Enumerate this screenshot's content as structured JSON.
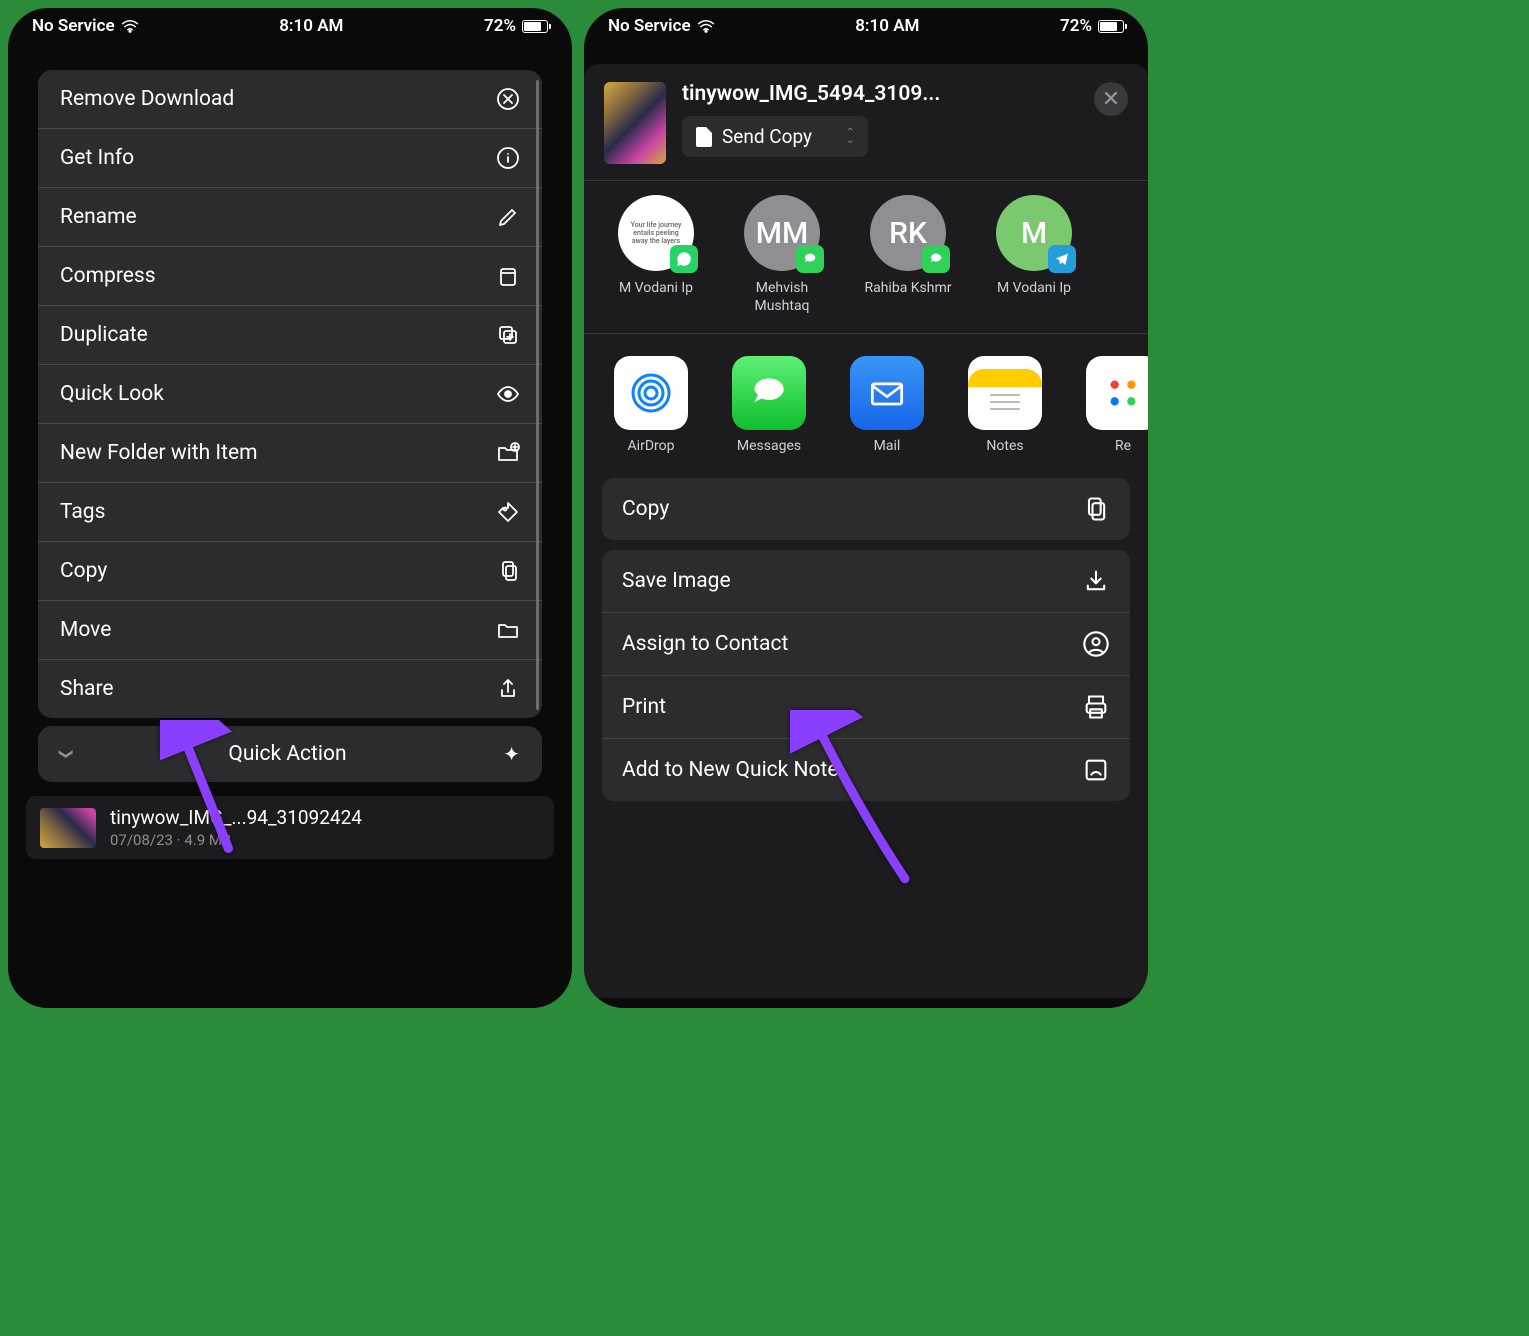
{
  "status": {
    "service": "No Service",
    "time": "8:10 AM",
    "battery": "72%"
  },
  "left": {
    "menu": [
      {
        "label": "Remove Download",
        "icon": "remove-icon"
      },
      {
        "label": "Get Info",
        "icon": "info-icon"
      },
      {
        "label": "Rename",
        "icon": "rename-icon"
      },
      {
        "label": "Compress",
        "icon": "compress-icon"
      },
      {
        "label": "Duplicate",
        "icon": "duplicate-icon"
      },
      {
        "label": "Quick Look",
        "icon": "eye-icon"
      },
      {
        "label": "New Folder with Item",
        "icon": "folder-plus-icon"
      },
      {
        "label": "Tags",
        "icon": "tag-icon"
      },
      {
        "label": "Copy",
        "icon": "copy-icon"
      },
      {
        "label": "Move",
        "icon": "folder-icon"
      },
      {
        "label": "Share",
        "icon": "share-icon"
      }
    ],
    "quick_actions": "Quick Action",
    "file": {
      "name": "tinywow_IMG_...94_31092424",
      "sub": "07/08/23 · 4.9 MB"
    }
  },
  "right": {
    "title": "tinywow_IMG_5494_3109...",
    "send_copy": "Send Copy",
    "contacts": [
      {
        "name": "M Vodani Ip",
        "initials": "",
        "bg": "#fff",
        "badge": "#25d366"
      },
      {
        "name": "Mehvish Mushtaq",
        "initials": "MM",
        "bg": "#8e8e93",
        "badge": "#30d158"
      },
      {
        "name": "Rahiba Kshmr",
        "initials": "RK",
        "bg": "#8e8e93",
        "badge": "#30d158"
      },
      {
        "name": "M Vodani Ip",
        "initials": "M",
        "bg": "#7bc96f",
        "badge": "#229ed9"
      }
    ],
    "apps": [
      {
        "name": "AirDrop",
        "bg": "#fff"
      },
      {
        "name": "Messages",
        "bg": "#30d158"
      },
      {
        "name": "Mail",
        "bg": "#1f6ff0"
      },
      {
        "name": "Notes",
        "bg": "#fff"
      },
      {
        "name": "Re",
        "bg": "#fff"
      }
    ],
    "copy": "Copy",
    "actions": [
      {
        "label": "Save Image",
        "icon": "download-icon"
      },
      {
        "label": "Assign to Contact",
        "icon": "person-icon"
      },
      {
        "label": "Print",
        "icon": "print-icon"
      },
      {
        "label": "Add to New Quick Note",
        "icon": "note-icon"
      }
    ]
  }
}
